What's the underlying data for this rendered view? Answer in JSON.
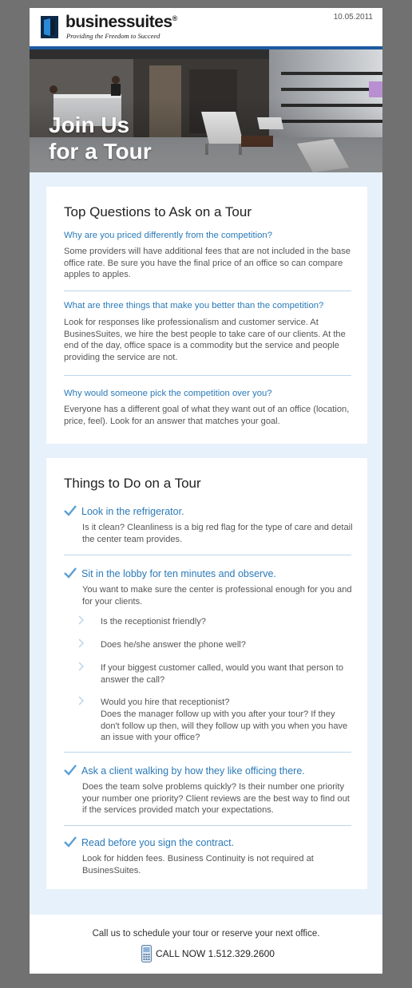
{
  "header": {
    "brand": "businessuites",
    "brand_mark": "®",
    "tagline": "Providing the Freedom to Succeed",
    "date": "10.05.2011"
  },
  "hero": {
    "title_line1": "Join Us",
    "title_line2": "for a Tour"
  },
  "questions": {
    "title": "Top Questions to Ask on a Tour",
    "items": [
      {
        "q": "Why are you priced differently from the competition?",
        "a": "Some providers will have additional fees that are not included in the base office rate. Be sure you have the final price of an office so can compare apples to apples."
      },
      {
        "q": "What are three things that make you better than the competition?",
        "a": "Look for responses like professionalism and customer service. At BusinesSuites, we hire the best people to take care of our clients. At the end of the day, office space is a commodity but the service and people providing the service are not."
      },
      {
        "q": "Why would someone pick the competition over you?",
        "a": "Everyone has a different goal of what they want out of an office (location, price, feel). Look for an answer that matches your goal."
      }
    ]
  },
  "todo": {
    "title": "Things to Do on a Tour",
    "items": [
      {
        "head": "Look in the refrigerator.",
        "body": "Is it clean? Cleanliness is a big red flag for the type of care and detail the center team provides."
      },
      {
        "head": "Sit in the lobby for ten minutes and observe.",
        "body": "You want to make sure the center is professional enough for you and for your clients.",
        "subs": [
          "Is the receptionist friendly?",
          "Does he/she answer the phone well?",
          "If your biggest customer called, would you want that person to answer the call?",
          "Would you hire that receptionist?",
          "Does the manager follow up with you after your tour? If they don't follow up then, will they follow up with you when you have an issue with your office?"
        ]
      },
      {
        "head": "Ask a client walking by how they like officing there.",
        "body": "Does the team solve problems quickly? Is their number one priority your number one priority? Client reviews are the best way to find out if the services provided match your expectations."
      },
      {
        "head": "Read before you sign the contract.",
        "body": "Look for hidden fees. Business Continuity is not required at BusinesSuites."
      }
    ]
  },
  "footer": {
    "cta": "Call us to schedule your tour or reserve your next office.",
    "call": "CALL NOW 1.512.329.2600"
  },
  "colors": {
    "accent": "#2b7ab8",
    "brand_blue": "#1c5aa0",
    "content_bg": "#e7f1fb",
    "outer_bg": "#717171"
  },
  "icons": [
    "logo-mark-icon",
    "hero-photo",
    "check-icon",
    "arrow-bullet-icon",
    "phone-icon"
  ]
}
